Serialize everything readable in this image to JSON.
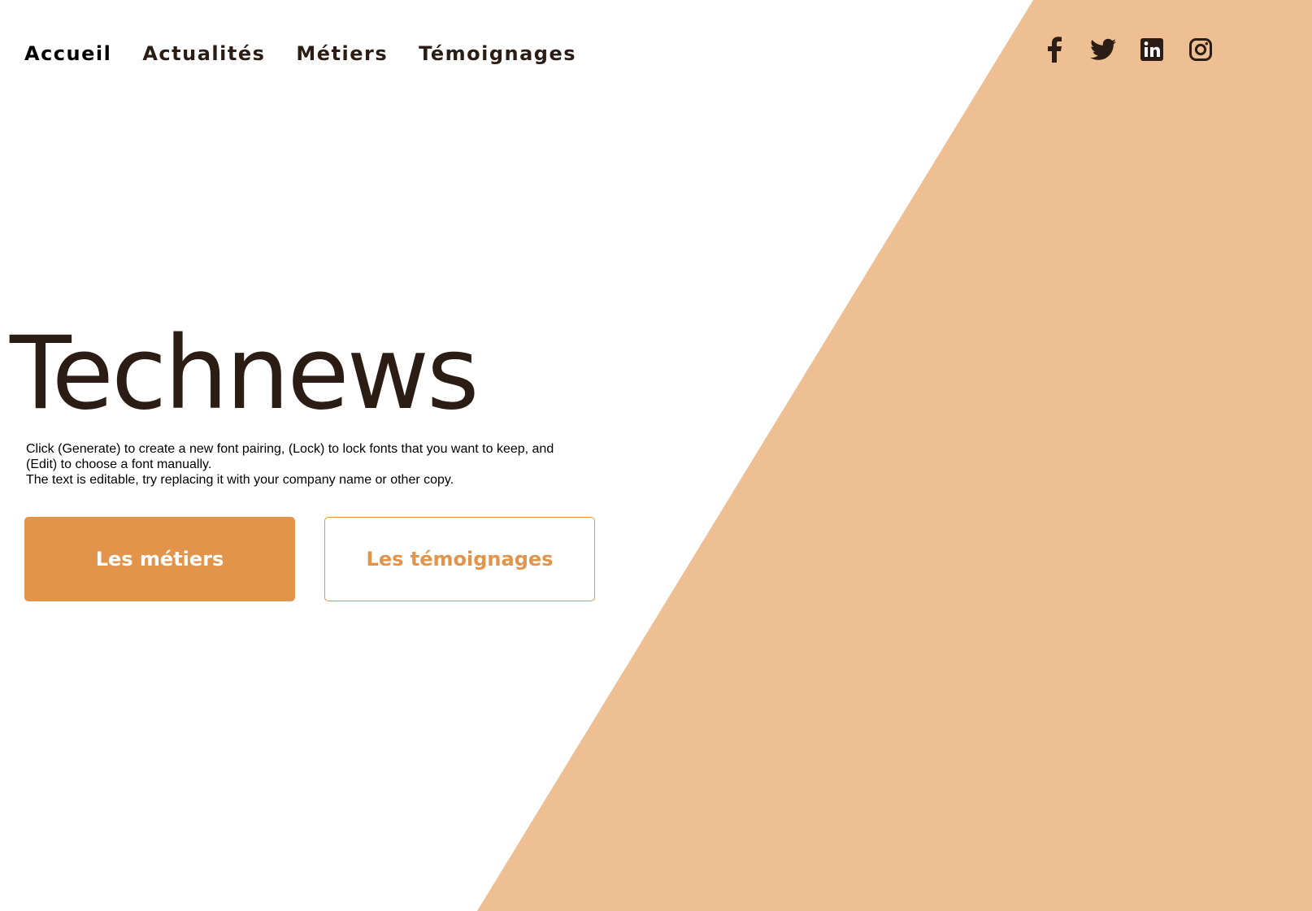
{
  "colors": {
    "background": "#ffffff",
    "accent_shape": "#eebf92",
    "primary_button": "#e2944a",
    "text_dark": "#2b1d14"
  },
  "nav": {
    "items": [
      {
        "label": "Accueil"
      },
      {
        "label": "Actualités"
      },
      {
        "label": "Métiers"
      },
      {
        "label": "Témoignages"
      }
    ]
  },
  "social": {
    "icons": [
      "facebook-icon",
      "twitter-icon",
      "linkedin-icon",
      "instagram-icon"
    ]
  },
  "hero": {
    "title": "Technews",
    "description_lines": [
      "Click (Generate) to create a new font pairing, (Lock) to lock fonts that you want to keep, and (Edit) to choose a font manually.",
      "The text is editable, try replacing it with your company name or other copy."
    ],
    "primary_button": "Les métiers",
    "secondary_button": "Les témoignages"
  }
}
